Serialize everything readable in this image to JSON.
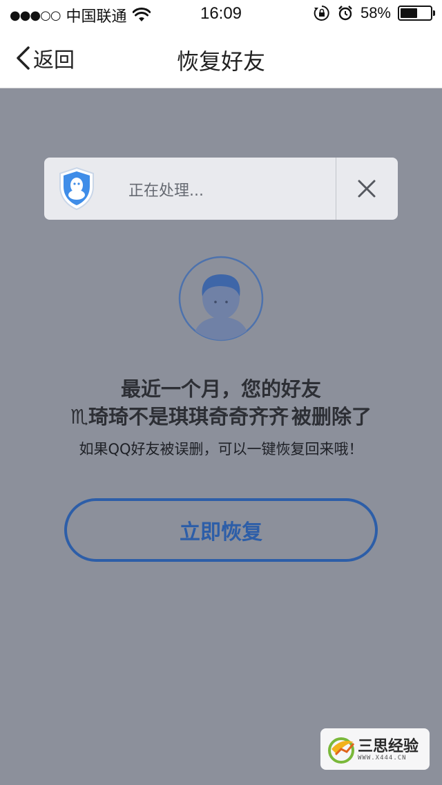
{
  "status_bar": {
    "signal": "●●●○○",
    "carrier": "中国联通",
    "time": "16:09",
    "battery_text": "58%",
    "battery_level": 0.58,
    "icons": [
      "wifi-icon",
      "rotation-lock-icon",
      "alarm-icon",
      "battery-icon"
    ]
  },
  "nav": {
    "back_label": "返回",
    "title": "恢复好友"
  },
  "toast": {
    "text": "正在处理...",
    "logo": "qq-shield-icon",
    "close_icon": "close-icon"
  },
  "content": {
    "avatar_icon": "person-avatar-icon",
    "line1": "最近一个月，您的好友",
    "line2_name": "♏琦琦不是琪琪奇奇齐齐",
    "line2_suffix": " 被删除了",
    "subtext": "如果QQ好友被误删，可以一键恢复回来哦！",
    "button_label": "立即恢复"
  },
  "watermark": {
    "title": "三思经验",
    "url": "WWW.X444.CN"
  },
  "colors": {
    "overlay": "#8c909b",
    "accent": "#2d5ea8"
  }
}
